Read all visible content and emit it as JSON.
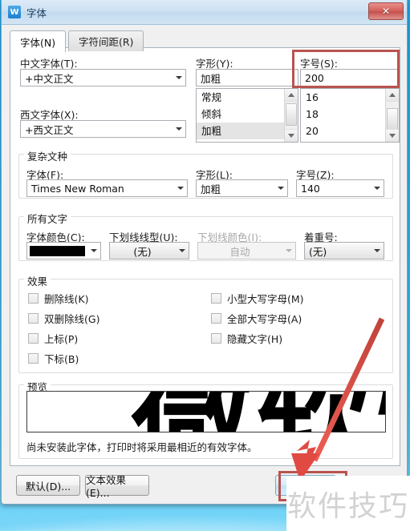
{
  "window": {
    "title": "字体",
    "app_icon": "w-logo-icon",
    "close_label": "✕"
  },
  "tabs": [
    {
      "label": "字体(N)",
      "active": true
    },
    {
      "label": "字符间距(R)",
      "active": false
    }
  ],
  "latin_section": {
    "chinese_font_label": "中文字体(T):",
    "chinese_font_value": "+中文正文",
    "western_font_label": "西文字体(X):",
    "western_font_value": "+西文正文",
    "style_label": "字形(Y):",
    "style_value": "加粗",
    "style_options": [
      "常规",
      "倾斜",
      "加粗"
    ],
    "style_selected": "加粗",
    "size_label": "字号(S):",
    "size_value": "200",
    "size_options": [
      "16",
      "18",
      "20"
    ]
  },
  "complex_section": {
    "title": "复杂文种",
    "font_label": "字体(F):",
    "font_value": "Times New Roman",
    "style_label": "字形(L):",
    "style_value": "加粗",
    "size_label": "字号(Z):",
    "size_value": "140"
  },
  "all_text_section": {
    "title": "所有文字",
    "color_label": "字体颜色(C):",
    "color_value": "#000000",
    "underline_style_label": "下划线线型(U):",
    "underline_style_value": "(无)",
    "underline_color_label": "下划线颜色(I):",
    "underline_color_value": "自动",
    "emphasis_label": "着重号:",
    "emphasis_value": "(无)"
  },
  "effects_section": {
    "title": "效果",
    "left": [
      {
        "label": "删除线(K)",
        "checked": false
      },
      {
        "label": "双删除线(G)",
        "checked": false
      },
      {
        "label": "上标(P)",
        "checked": false
      },
      {
        "label": "下标(B)",
        "checked": false
      }
    ],
    "right": [
      {
        "label": "小型大写字母(M)",
        "checked": false
      },
      {
        "label": "全部大写字母(A)",
        "checked": false
      },
      {
        "label": "隐藏文字(H)",
        "checked": false
      }
    ]
  },
  "preview_section": {
    "title": "预览",
    "sample_text": "微软雅黑",
    "note": "尚未安装此字体，打印时将采用最相近的有效字体。"
  },
  "footer": {
    "default_button": "默认(D)...",
    "text_effects_button": "文本效果(E)..."
  },
  "annotations": {
    "highlight_color": "#b9534f",
    "arrow_color": "#e04a42",
    "watermark_text": "软件技巧"
  }
}
